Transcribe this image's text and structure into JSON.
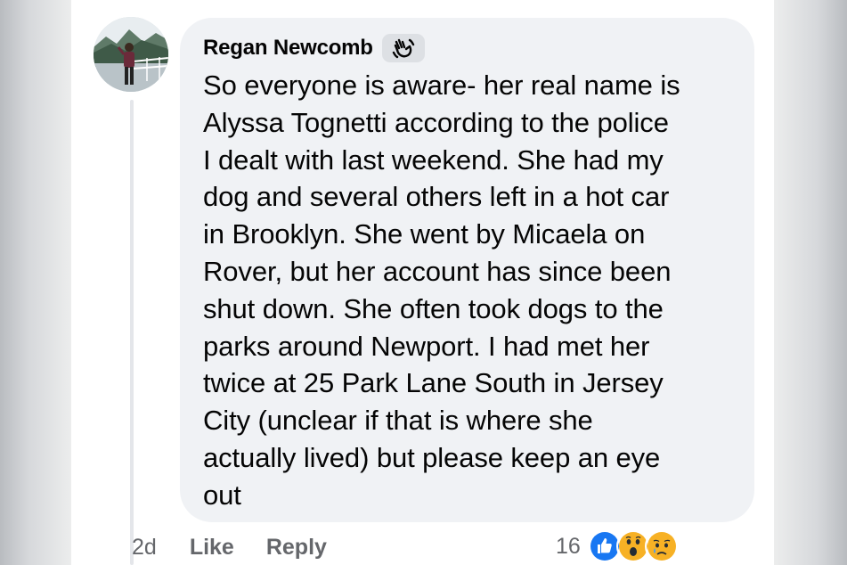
{
  "comment": {
    "author": "Regan Newcomb",
    "badge_icon": "waving-hand-icon",
    "text": "So everyone is aware- her real name is\nAlyssa Tognetti according to the police\nI dealt with last weekend. She had my\ndog and several others left in a hot car\nin Brooklyn. She went by Micaela on\nRover, but her account has since been\nshut down. She often took dogs to the\nparks around Newport. I had met her\ntwice at 25 Park Lane South in Jersey\nCity (unclear if that is where she\nactually lived) but please keep an eye\nout",
    "timestamp": "2d",
    "like_label": "Like",
    "reply_label": "Reply",
    "reaction_count": "16",
    "reactions": [
      "like",
      "wow",
      "sad"
    ]
  },
  "colors": {
    "bubble": "#f0f2f5",
    "meta_text": "#65676b",
    "like_blue": "#1877f2",
    "emoji_yellow": "#f7b125"
  }
}
